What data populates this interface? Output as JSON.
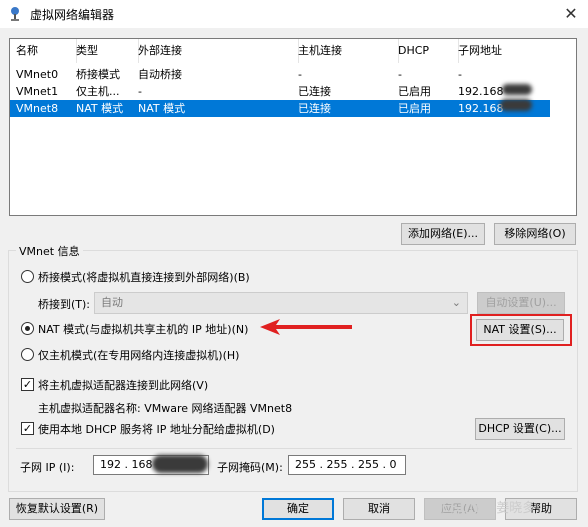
{
  "window": {
    "title": "虚拟网络编辑器",
    "close_glyph": "✕"
  },
  "table": {
    "headers": [
      "名称",
      "类型",
      "外部连接",
      "主机连接",
      "DHCP",
      "子网地址"
    ],
    "rows": [
      {
        "name": "VMnet0",
        "type": "桥接模式",
        "external": "自动桥接",
        "host": "-",
        "dhcp": "-",
        "subnet": "-",
        "selected": false
      },
      {
        "name": "VMnet1",
        "type": "仅主机...",
        "external": "-",
        "host": "已连接",
        "dhcp": "已启用",
        "subnet": "192.168",
        "selected": false
      },
      {
        "name": "VMnet8",
        "type": "NAT 模式",
        "external": "NAT 模式",
        "host": "已连接",
        "dhcp": "已启用",
        "subnet": "192.168",
        "selected": true
      }
    ]
  },
  "buttons": {
    "add_network": "添加网络(E)...",
    "remove_network": "移除网络(O)",
    "auto_settings": "自动设置(U)...",
    "nat_settings": "NAT 设置(S)...",
    "dhcp_settings": "DHCP 设置(C)...",
    "restore_defaults": "恢复默认设置(R)",
    "ok": "确定",
    "cancel": "取消",
    "apply": "应用(A)",
    "help": "帮助"
  },
  "vmnet_info": {
    "group_label": "VMnet 信息",
    "bridged_label": "桥接模式(将虚拟机直接连接到外部网络)(B)",
    "bridged_to_label": "桥接到(T):",
    "bridged_to_value": "自动",
    "nat_label": "NAT 模式(与虚拟机共享主机的 IP 地址)(N)",
    "hostonly_label": "仅主机模式(在专用网络内连接虚拟机)(H)",
    "connect_adapter_label": "将主机虚拟适配器连接到此网络(V)",
    "adapter_name_label": "主机虚拟适配器名称: VMware 网络适配器 VMnet8",
    "use_dhcp_label": "使用本地 DHCP 服务将 IP 地址分配给虚拟机(D)",
    "subnet_ip_label": "子网 IP (I):",
    "subnet_ip_value": "192 . 168",
    "subnet_mask_label": "子网掩码(M):",
    "subnet_mask_value": "255 . 255 . 255 . 0",
    "selected_mode": "nat",
    "connect_adapter_checked": true,
    "use_dhcp_checked": true
  },
  "watermark": "CSDN @姜晓多",
  "colors": {
    "selection": "#0078d7",
    "highlight": "#e02020"
  }
}
